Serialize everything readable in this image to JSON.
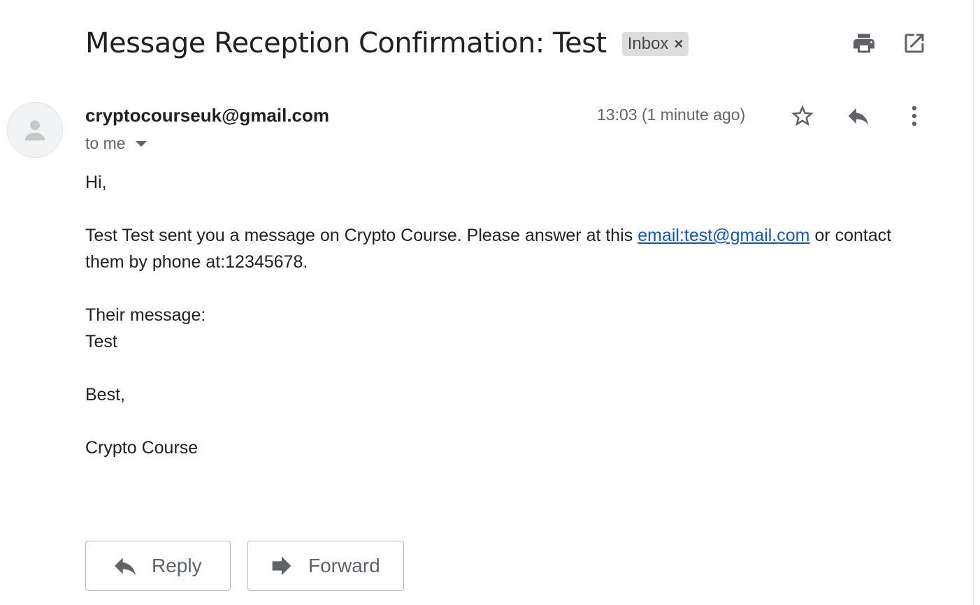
{
  "header": {
    "subject": "Message Reception Confirmation: Test",
    "label": "Inbox",
    "label_remove": "×",
    "print_icon": "print-icon",
    "popout_icon": "open-in-new-window-icon"
  },
  "message": {
    "sender": "cryptocourseuk@gmail.com",
    "recipient": "to me",
    "timestamp": "13:03 (1 minute ago)",
    "icons": [
      "avatar-placeholder",
      "star-icon",
      "reply-icon",
      "more-vertical-icon"
    ],
    "body": {
      "greeting": "Hi,",
      "line1_before_link": "Test Test sent you a message on Crypto Course. Please answer at this ",
      "link_text": "email:test@gmail.com",
      "line1_after_link": " or contact them by phone at:12345678.",
      "message_heading": "Their message:",
      "message_text": "Test",
      "signoff": "Best,",
      "signature": "Crypto Course"
    }
  },
  "actions": {
    "reply_label": "Reply",
    "forward_label": "Forward"
  },
  "colors": {
    "text": "#202124",
    "muted": "#5f6368",
    "link": "#1155cc",
    "chip_bg": "#dddddd",
    "icon": "#5f6368"
  }
}
